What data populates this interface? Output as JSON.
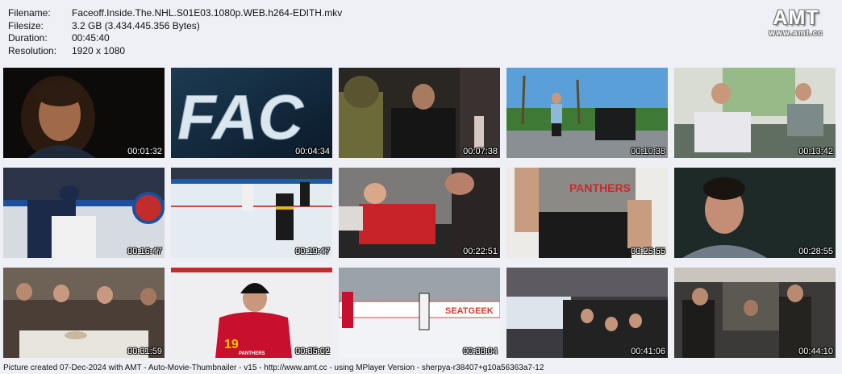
{
  "header": {
    "filename_label": "Filename:",
    "filename": "Faceoff.Inside.The.NHL.S01E03.1080p.WEB.h264-EDITH.mkv",
    "filesize_label": "Filesize:",
    "filesize": "3.2 GB (3.434.445.356 Bytes)",
    "duration_label": "Duration:",
    "duration": "00:45:40",
    "resolution_label": "Resolution:",
    "resolution": "1920 x 1080"
  },
  "logo": {
    "main": "AMT",
    "sub": "www.amt.cc"
  },
  "thumbnails": [
    {
      "time": "00:01:32",
      "scene": "woman-interview-portrait"
    },
    {
      "time": "00:04:34",
      "scene": "title-card-fac"
    },
    {
      "time": "00:07:38",
      "scene": "locker-room-player"
    },
    {
      "time": "00:10:38",
      "scene": "outdoor-palm-trees-cart"
    },
    {
      "time": "00:13:42",
      "scene": "men-on-couch"
    },
    {
      "time": "00:16:47",
      "scene": "hockey-board-battle"
    },
    {
      "time": "00:19:47",
      "scene": "hockey-game-rink"
    },
    {
      "time": "00:22:51",
      "scene": "player-on-treatment-table"
    },
    {
      "time": "00:25:55",
      "scene": "panthers-shirt-closeup"
    },
    {
      "time": "00:28:55",
      "scene": "man-smiling-portrait"
    },
    {
      "time": "00:31:59",
      "scene": "group-dinner"
    },
    {
      "time": "00:35:02",
      "scene": "panthers-player-19"
    },
    {
      "time": "00:38:04",
      "scene": "practice-rink-seatgeek"
    },
    {
      "time": "00:41:06",
      "scene": "bench-celebration"
    },
    {
      "time": "00:44:10",
      "scene": "team-hallway"
    }
  ],
  "texts": {
    "fac": "FAC",
    "seatgeek": "SEATGEEK",
    "jersey_number": "19",
    "panthers": "PANTHERS",
    "aerial": "PANTHERS"
  },
  "footer": "Picture created 07-Dec-2024 with AMT - Auto-Movie-Thumbnailer - v15 - http://www.amt.cc - using MPlayer Version - sherpya-r38407+g10a56363a7-12"
}
